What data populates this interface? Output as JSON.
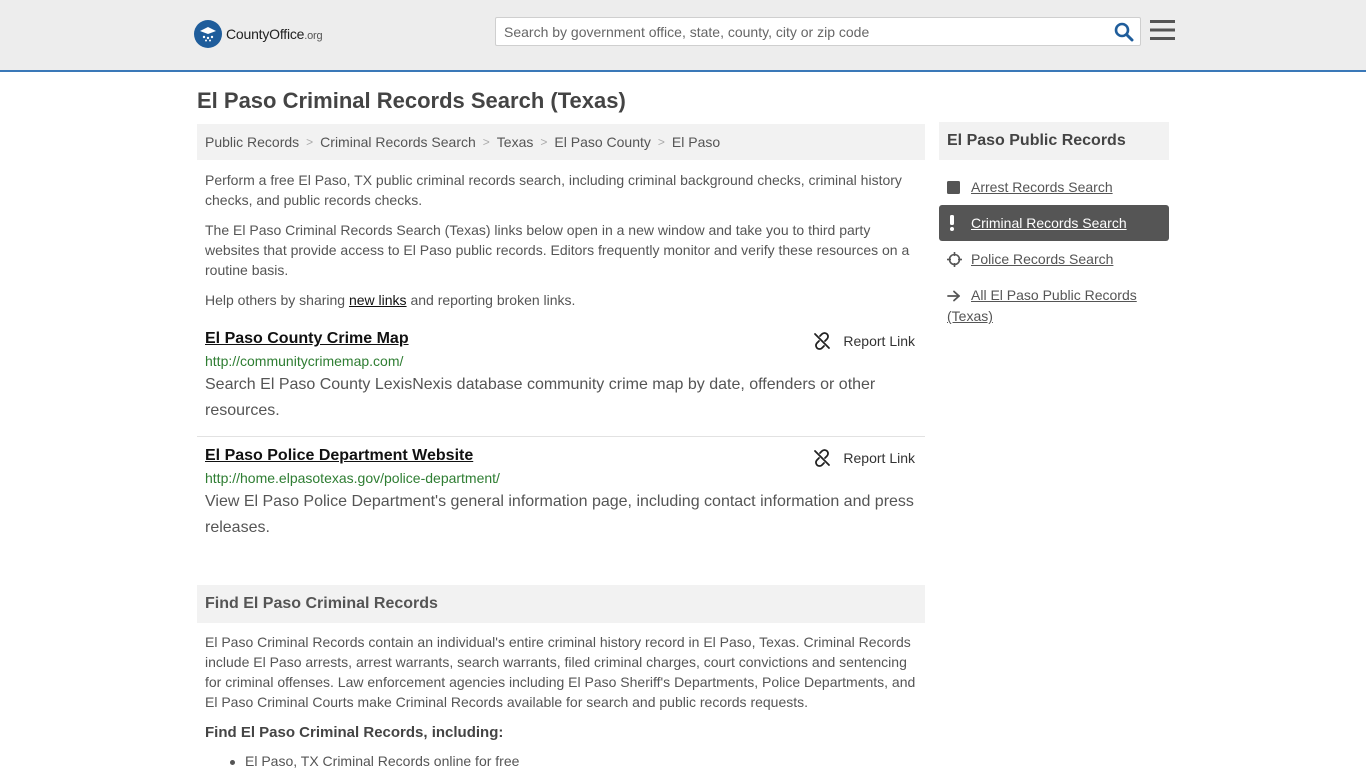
{
  "header": {
    "logo_text_main": "CountyOffice",
    "logo_text_org": ".org",
    "search_placeholder": "Search by government office, state, county, city or zip code"
  },
  "page": {
    "title": "El Paso Criminal Records Search (Texas)"
  },
  "breadcrumb": [
    "Public Records",
    "Criminal Records Search",
    "Texas",
    "El Paso County",
    "El Paso"
  ],
  "intro": {
    "p1": "Perform a free El Paso, TX public criminal records search, including criminal background checks, criminal history checks, and public records checks.",
    "p2": "The El Paso Criminal Records Search (Texas) links below open in a new window and take you to third party websites that provide access to El Paso public records. Editors frequently monitor and verify these resources on a routine basis.",
    "p3_before": "Help others by sharing ",
    "p3_link": "new links",
    "p3_after": " and reporting broken links."
  },
  "entries": [
    {
      "title": "El Paso County Crime Map",
      "url": "http://communitycrimemap.com/",
      "description": "Search El Paso County LexisNexis database community crime map by date, offenders or other resources.",
      "report_label": "Report Link"
    },
    {
      "title": "El Paso Police Department Website",
      "url": "http://home.elpasotexas.gov/police-department/",
      "description": "View El Paso Police Department's general information page, including contact information and press releases.",
      "report_label": "Report Link"
    }
  ],
  "find_section": {
    "heading": "Find El Paso Criminal Records",
    "body": "El Paso Criminal Records contain an individual's entire criminal history record in El Paso, Texas. Criminal Records include El Paso arrests, arrest warrants, search warrants, filed criminal charges, court convictions and sentencing for criminal offenses. Law enforcement agencies including El Paso Sheriff's Departments, Police Departments, and El Paso Criminal Courts make Criminal Records available for search and public records requests.",
    "subheading": "Find El Paso Criminal Records, including:",
    "bullets": [
      "El Paso, TX Criminal Records online for free"
    ]
  },
  "sidebar": {
    "heading": "El Paso Public Records",
    "items": [
      {
        "label": "Arrest Records Search",
        "icon": "square-icon"
      },
      {
        "label": "Criminal Records Search",
        "icon": "exclamation-icon",
        "active": true
      },
      {
        "label": "Police Records Search",
        "icon": "crosshair-icon"
      },
      {
        "label": "All El Paso Public Records (Texas)",
        "icon": "arrow-right-icon"
      }
    ]
  },
  "colors": {
    "accent_blue": "#3a78b8",
    "url_green": "#2e7d32",
    "active_bg": "#555555"
  }
}
